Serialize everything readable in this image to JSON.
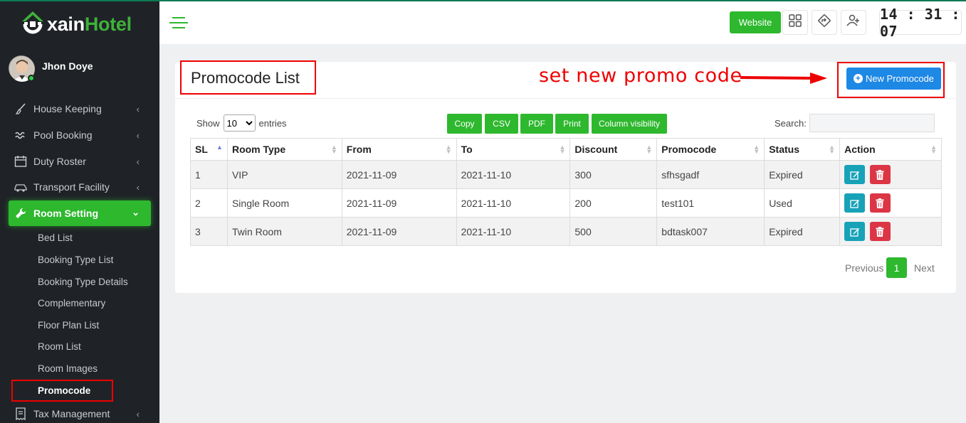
{
  "brand": {
    "logo_prefix": "xain",
    "logo_suffix": "Hotel"
  },
  "user": {
    "name": "Jhon Doye"
  },
  "sidebar": {
    "items": [
      {
        "label": "House Keeping",
        "icon": "broom-icon"
      },
      {
        "label": "Pool Booking",
        "icon": "waves-icon"
      },
      {
        "label": "Duty Roster",
        "icon": "calendar-icon"
      },
      {
        "label": "Transport Facility",
        "icon": "car-icon"
      },
      {
        "label": "Room Setting",
        "icon": "wrench-icon"
      },
      {
        "label": "Tax Management",
        "icon": "receipt-icon"
      }
    ],
    "subitems": [
      "Bed List",
      "Booking Type List",
      "Booking Type Details",
      "Complementary",
      "Floor Plan List",
      "Room List",
      "Room Images",
      "Promocode"
    ]
  },
  "header": {
    "website_label": "Website",
    "clock": "14 : 31 : 07"
  },
  "page": {
    "title": "Promocode List",
    "annotation": "set new promo code",
    "new_button": "New Promocode"
  },
  "table_controls": {
    "show_label": "Show",
    "entries_value": "10",
    "entries_label": "entries",
    "buttons": [
      "Copy",
      "CSV",
      "PDF",
      "Print",
      "Column visibility"
    ],
    "search_label": "Search:"
  },
  "table": {
    "columns": [
      "SL",
      "Room Type",
      "From",
      "To",
      "Discount",
      "Promocode",
      "Status",
      "Action"
    ],
    "rows": [
      [
        "1",
        "VIP",
        "2021-11-09",
        "2021-11-10",
        "300",
        "sfhsgadf",
        "Expired"
      ],
      [
        "2",
        "Single Room",
        "2021-11-09",
        "2021-11-10",
        "200",
        "test101",
        "Used"
      ],
      [
        "3",
        "Twin Room",
        "2021-11-09",
        "2021-11-10",
        "500",
        "bdtask007",
        "Expired"
      ]
    ]
  },
  "pagination": {
    "previous": "Previous",
    "current": "1",
    "next": "Next"
  },
  "colors": {
    "brand_green": "#2eb82e",
    "sidebar_bg": "#1f2327",
    "primary_blue": "#1e88e5",
    "annotation_red": "#e00000"
  }
}
